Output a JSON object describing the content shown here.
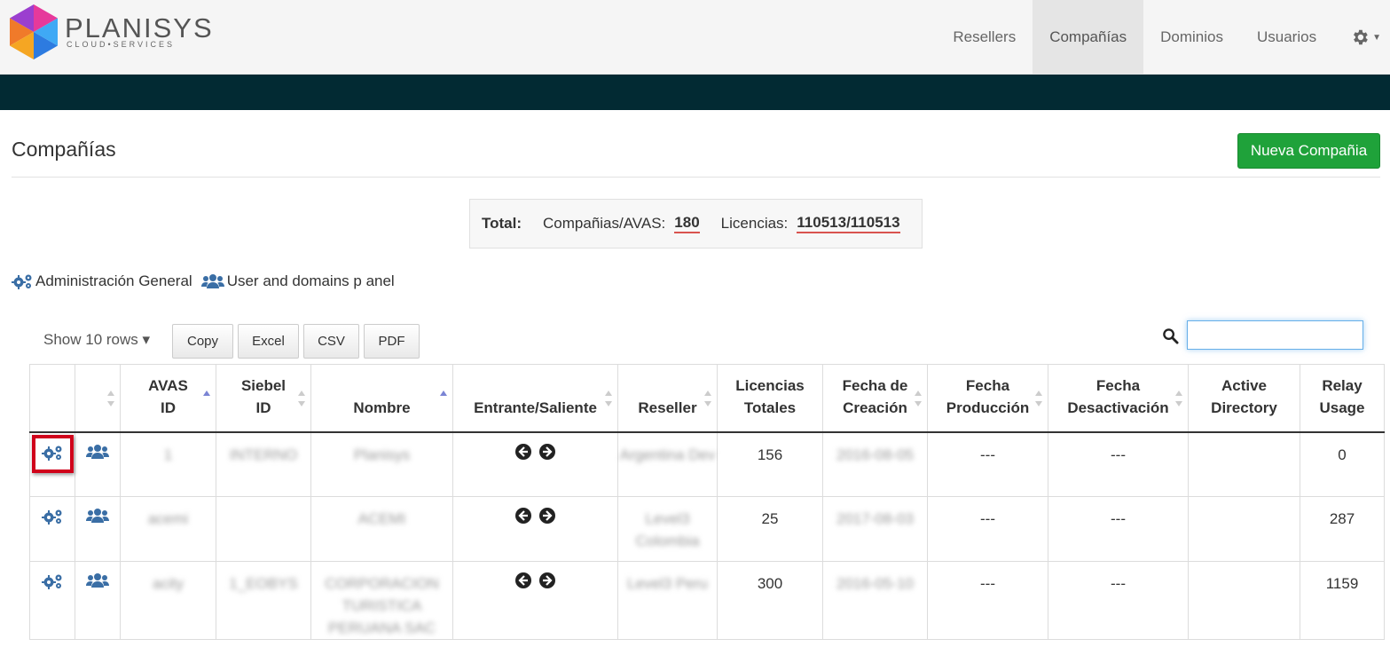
{
  "app": {
    "logo_text": "PLANISYS",
    "logo_sub": "CLOUD•SERVICES"
  },
  "nav": {
    "items": [
      "Resellers",
      "Compañías",
      "Dominios",
      "Usuarios"
    ],
    "active": "Compañías",
    "settings_icon": "gear-icon"
  },
  "page": {
    "title": "Compañías",
    "new_button": "Nueva Compañia"
  },
  "totals": {
    "label": "Total:",
    "companies_label": "Compañias/AVAS:",
    "companies_value": "180",
    "licenses_label": "Licencias:",
    "licenses_value": "110513/110513"
  },
  "legend": {
    "admin_label": "Administración General",
    "users_label": "User and domains p anel"
  },
  "toolbar": {
    "show_rows": "Show 10 rows ▾",
    "buttons": [
      "Copy",
      "Excel",
      "CSV",
      "PDF"
    ],
    "search_value": ""
  },
  "table": {
    "headers": [
      {
        "line1": "",
        "line2": ""
      },
      {
        "line1": "",
        "line2": ""
      },
      {
        "line1": "AVAS",
        "line2": "ID"
      },
      {
        "line1": "Siebel",
        "line2": "ID"
      },
      {
        "line1": "",
        "line2": "Nombre"
      },
      {
        "line1": "",
        "line2": "Entrante/Saliente"
      },
      {
        "line1": "",
        "line2": "Reseller"
      },
      {
        "line1": "Licencias",
        "line2": "Totales"
      },
      {
        "line1": "Fecha de",
        "line2": "Creación"
      },
      {
        "line1": "Fecha",
        "line2": "Producción"
      },
      {
        "line1": "Fecha",
        "line2": "Desactivación"
      },
      {
        "line1": "Active",
        "line2": "Directory"
      },
      {
        "line1": "Relay",
        "line2": "Usage"
      }
    ],
    "rows": [
      {
        "avas": "1",
        "siebel": "INTERNO",
        "nombre": "Planisys",
        "reseller": "Argentina Dev",
        "licencias": "156",
        "creacion": "2016-08-05",
        "produccion": "---",
        "desactivacion": "---",
        "ad": "",
        "relay": "0"
      },
      {
        "avas": "acemi",
        "siebel": "",
        "nombre": "ACEMI",
        "reseller": "Level3 Colombia",
        "licencias": "25",
        "creacion": "2017-08-03",
        "produccion": "---",
        "desactivacion": "---",
        "ad": "",
        "relay": "287"
      },
      {
        "avas": "acity",
        "siebel": "1_EOBYS",
        "nombre": "CORPORACION TURISTICA PERUANA SAC",
        "reseller": "Level3 Peru",
        "licencias": "300",
        "creacion": "2016-05-10",
        "produccion": "---",
        "desactivacion": "---",
        "ad": "",
        "relay": "1159"
      }
    ]
  },
  "colors": {
    "navbar_bg": "#f5f5f5",
    "darkbar": "#022a33",
    "new_button": "#1fa23a",
    "icon_blue": "#3a6ea5",
    "highlight": "#d0021b"
  }
}
